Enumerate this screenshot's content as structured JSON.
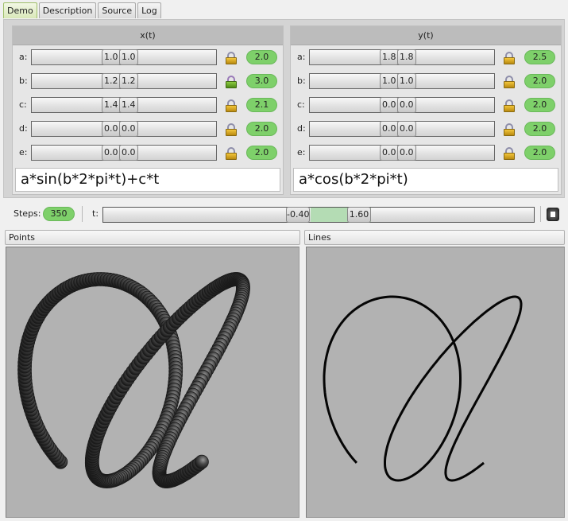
{
  "tabs": [
    {
      "label": "Demo",
      "active": true
    },
    {
      "label": "Description",
      "active": false
    },
    {
      "label": "Source",
      "active": false
    },
    {
      "label": "Log",
      "active": false
    }
  ],
  "x_group": {
    "title": "x(t)",
    "params": [
      {
        "name": "a:",
        "low": "1.0",
        "high": "1.0",
        "lock": "locked",
        "range": "2.0",
        "position": 0.5
      },
      {
        "name": "b:",
        "low": "1.2",
        "high": "1.2",
        "lock": "locked-green",
        "range": "3.0",
        "position": 0.5
      },
      {
        "name": "c:",
        "low": "1.4",
        "high": "1.4",
        "lock": "locked",
        "range": "2.1",
        "position": 0.5
      },
      {
        "name": "d:",
        "low": "0.0",
        "high": "0.0",
        "lock": "locked",
        "range": "2.0",
        "position": 0.5
      },
      {
        "name": "e:",
        "low": "0.0",
        "high": "0.0",
        "lock": "locked",
        "range": "2.0",
        "position": 0.5
      }
    ],
    "expression": "a*sin(b*2*pi*t)+c*t"
  },
  "y_group": {
    "title": "y(t)",
    "params": [
      {
        "name": "a:",
        "low": "1.8",
        "high": "1.8",
        "lock": "locked",
        "range": "2.5",
        "position": 0.5
      },
      {
        "name": "b:",
        "low": "1.0",
        "high": "1.0",
        "lock": "locked",
        "range": "2.0",
        "position": 0.5
      },
      {
        "name": "c:",
        "low": "0.0",
        "high": "0.0",
        "lock": "locked",
        "range": "2.0",
        "position": 0.5
      },
      {
        "name": "d:",
        "low": "0.0",
        "high": "0.0",
        "lock": "locked",
        "range": "2.0",
        "position": 0.5
      },
      {
        "name": "e:",
        "low": "0.0",
        "high": "0.0",
        "lock": "locked",
        "range": "2.0",
        "position": 0.5
      }
    ],
    "expression": "a*cos(b*2*pi*t)"
  },
  "steps": {
    "label": "Steps:",
    "value": "350"
  },
  "t_range": {
    "label": "t:",
    "low": "-0.40",
    "high": "1.60"
  },
  "stop_icon": "stop-icon",
  "views": {
    "points": {
      "title": "Points"
    },
    "lines": {
      "title": "Lines"
    }
  },
  "colors": {
    "pill": "#7ed06a",
    "range_fill": "#b4dcb4",
    "canvas_bg": "#b2b2b2",
    "active_tab": "#d9e8b9"
  }
}
